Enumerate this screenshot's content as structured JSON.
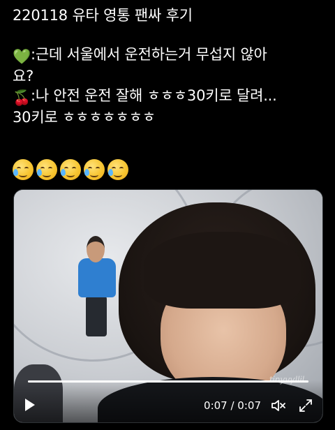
{
  "tweet": {
    "title_line": "220118 유타 영통 팬싸 후기",
    "q_emoji": "💚",
    "q_text": ":근데 서울에서 운전하는거 무섭지 않아",
    "q_text2": "요?",
    "a_emoji": "🍒",
    "a_text": ":나 안전 운전 잘해 ㅎㅎㅎ30키로 달려...",
    "a_text2": "30키로 ㅎㅎㅎㅎㅎㅎㅎ",
    "reaction_icon": "face-holding-back-tears-icon",
    "reaction_count": 5
  },
  "video": {
    "progress": 1.0,
    "time_display": "0:07 / 0:07",
    "watermark": "tinyvyllil",
    "play_icon": "play-icon",
    "mute_icon": "speaker-muted-icon",
    "fullscreen_icon": "fullscreen-icon"
  },
  "colors": {
    "background": "#000000",
    "text": "#ffffff",
    "border": "#2f3336"
  }
}
